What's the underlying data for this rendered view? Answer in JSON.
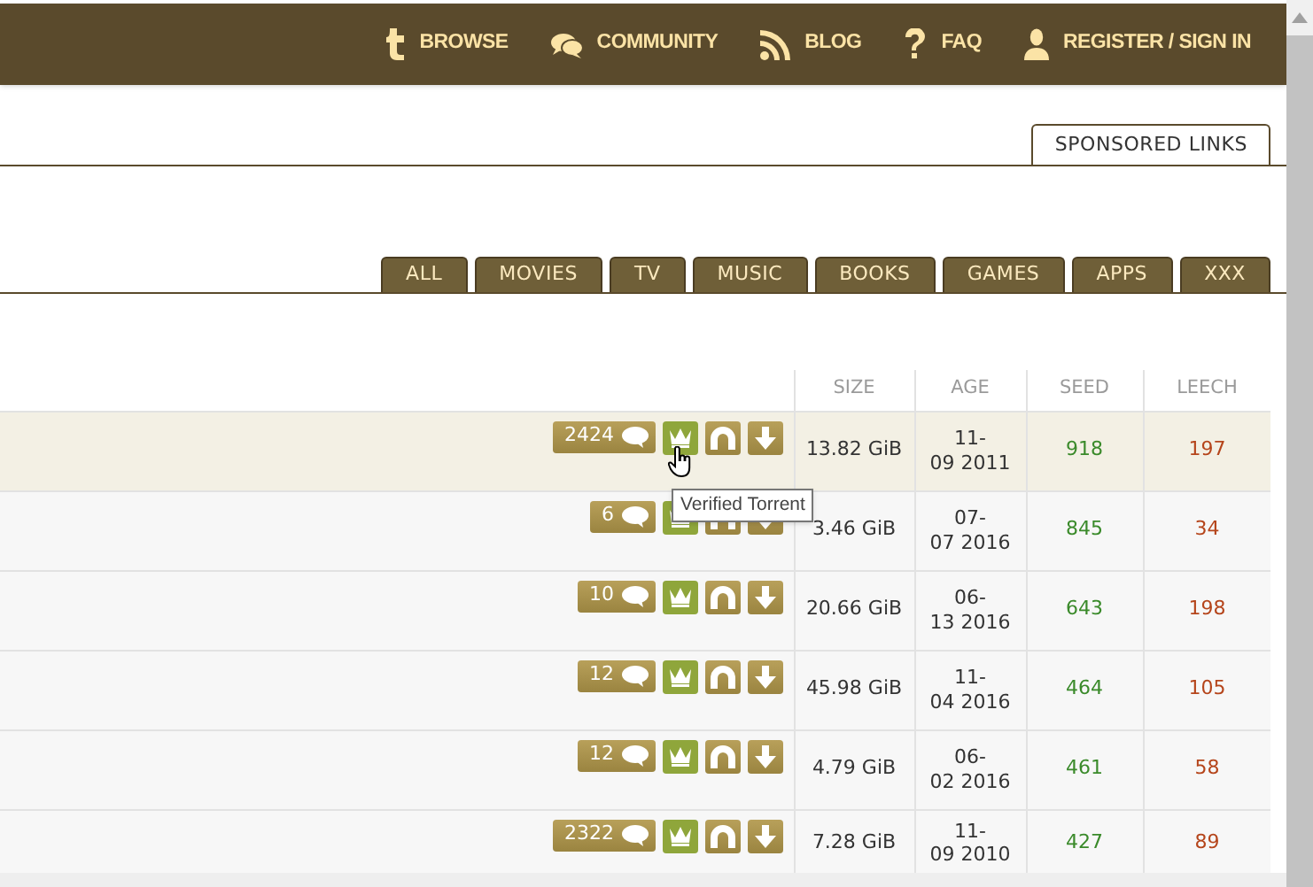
{
  "nav": [
    {
      "kind": "browse",
      "label": "BROWSE"
    },
    {
      "kind": "community",
      "label": "COMMUNITY"
    },
    {
      "kind": "blog",
      "label": "BLOG"
    },
    {
      "kind": "faq",
      "label": "FAQ"
    },
    {
      "kind": "register",
      "label": "REGISTER / SIGN IN"
    }
  ],
  "sponsored_tab": {
    "label": "SPONSORED LINKS"
  },
  "category_tabs": [
    {
      "label": "ALL",
      "selected": false
    },
    {
      "label": "MOVIES",
      "selected": false
    },
    {
      "label": "TV",
      "selected": false
    },
    {
      "label": "MUSIC",
      "selected": false
    },
    {
      "label": "BOOKS",
      "selected": false
    },
    {
      "label": "GAMES",
      "selected": false
    },
    {
      "label": "APPS",
      "selected": false
    },
    {
      "label": "XXX",
      "selected": false
    }
  ],
  "table": {
    "columns": [
      "SIZE",
      "AGE",
      "SEED",
      "LEECH"
    ],
    "rows": [
      {
        "comments": "2424",
        "verified": true,
        "size": "13.82 GiB",
        "age": [
          "11-",
          "09 2011"
        ],
        "seed": "918",
        "leech": "197",
        "hovered": true
      },
      {
        "comments": "6",
        "verified": true,
        "size": "3.46 GiB",
        "age": [
          "07-",
          "07 2016"
        ],
        "seed": "845",
        "leech": "34",
        "hovered": false
      },
      {
        "comments": "10",
        "verified": true,
        "size": "20.66 GiB",
        "age": [
          "06-",
          "13 2016"
        ],
        "seed": "643",
        "leech": "198",
        "hovered": false
      },
      {
        "comments": "12",
        "verified": true,
        "size": "45.98 GiB",
        "age": [
          "11-",
          "04 2016"
        ],
        "seed": "464",
        "leech": "105",
        "hovered": false
      },
      {
        "comments": "12",
        "verified": true,
        "size": "4.79 GiB",
        "age": [
          "06-",
          "02 2016"
        ],
        "seed": "461",
        "leech": "58",
        "hovered": false
      },
      {
        "comments": "2322",
        "verified": true,
        "size": "7.28 GiB",
        "age": [
          "11-",
          "09 2010"
        ],
        "seed": "427",
        "leech": "89",
        "hovered": false
      }
    ]
  },
  "tooltip": {
    "text": "Verified Torrent"
  }
}
